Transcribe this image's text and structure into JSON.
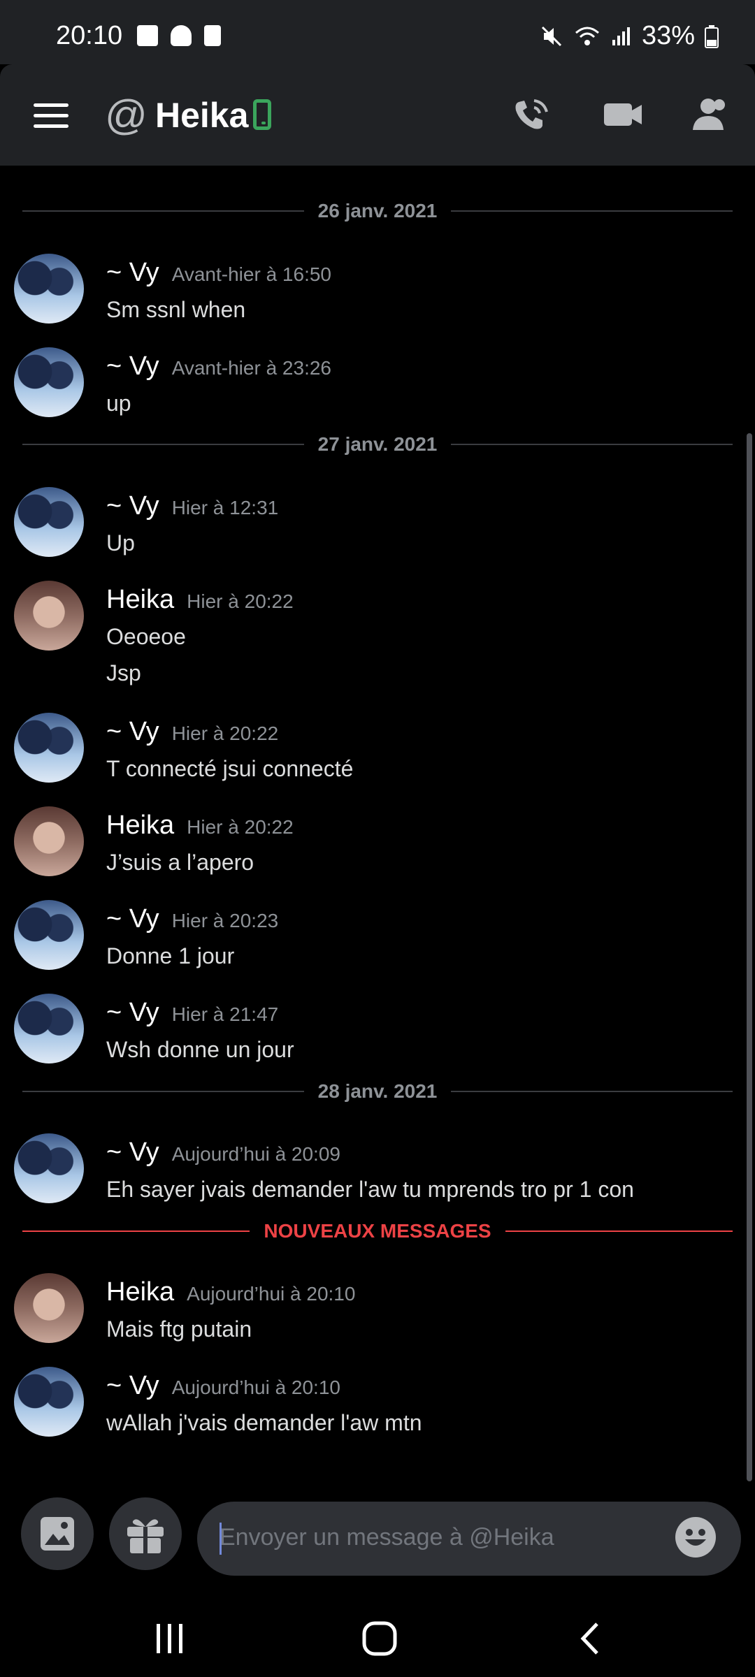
{
  "status_bar": {
    "time": "20:10",
    "battery": "33%"
  },
  "header": {
    "at_symbol": "@",
    "title": "Heika"
  },
  "messages": [
    {
      "type": "divider",
      "text": "26 janv. 2021"
    },
    {
      "author": "~ Vy",
      "time": "Avant-hier à 16:50",
      "lines": [
        "Sm ssnl when"
      ]
    },
    {
      "author": "~ Vy",
      "time": "Avant-hier à 23:26",
      "lines": [
        "up"
      ]
    },
    {
      "type": "divider",
      "text": "27 janv. 2021"
    },
    {
      "author": "~ Vy",
      "time": "Hier à 12:31",
      "lines": [
        "Up"
      ]
    },
    {
      "author": "Heika",
      "time": "Hier à 20:22",
      "lines": [
        "Oeoeoe",
        "Jsp"
      ]
    },
    {
      "author": "~ Vy",
      "time": "Hier à 20:22",
      "lines": [
        "T connecté jsui connecté"
      ]
    },
    {
      "author": "Heika",
      "time": "Hier à 20:22",
      "lines": [
        "J’suis a l’apero"
      ]
    },
    {
      "author": "~ Vy",
      "time": "Hier à 20:23",
      "lines": [
        "Donne 1 jour"
      ]
    },
    {
      "author": "~ Vy",
      "time": "Hier à 21:47",
      "lines": [
        "Wsh donne un jour"
      ]
    },
    {
      "type": "divider",
      "text": "28 janv. 2021"
    },
    {
      "author": "~ Vy",
      "time": "Aujourd’hui à 20:09",
      "lines": [
        "Eh sayer jvais demander l'aw tu mprends tro pr 1 con"
      ]
    },
    {
      "type": "new_divider",
      "text": "NOUVEAUX MESSAGES"
    },
    {
      "author": "Heika",
      "time": "Aujourd’hui à 20:10",
      "lines": [
        "Mais ftg putain"
      ]
    },
    {
      "author": "~ Vy",
      "time": "Aujourd’hui à 20:10",
      "lines": [
        "wAllah j'vais demander l'aw mtn"
      ]
    }
  ],
  "input": {
    "placeholder": "Envoyer un message à @Heika"
  },
  "colors": {
    "background": "#000000",
    "header": "#202225",
    "input": "#2f3136",
    "new_messages": "#ed4245",
    "online_phone": "#3ba55c"
  }
}
